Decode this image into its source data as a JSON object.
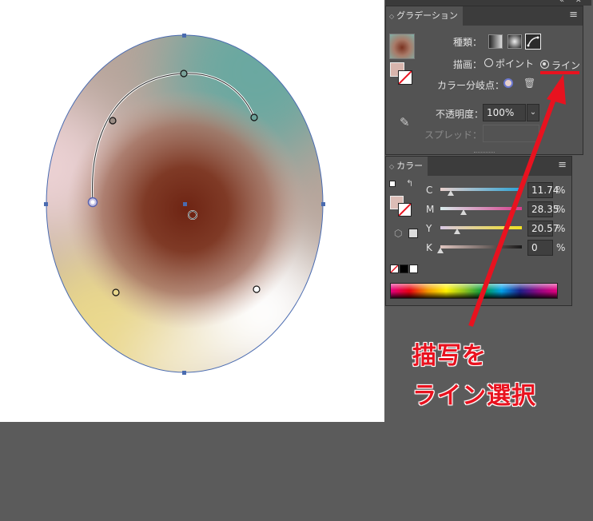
{
  "colors": {
    "accent": "#e8121f",
    "panel_bg": "#535353",
    "artboard": "#ffffff",
    "workspace": "#5b5b5b"
  },
  "gradient_panel": {
    "tab_label": "グラデーション",
    "menu_icon": "≡",
    "type_label": "種類：",
    "draw_label": "描画：",
    "draw_options": [
      "ポイント",
      "ライン"
    ],
    "draw_selected": "ライン",
    "color_stop_label": "カラー分岐点：",
    "opacity_label": "不透明度：",
    "opacity_value": "100%",
    "spread_label": "スプレッド："
  },
  "color_panel": {
    "tab_label": "カラー",
    "menu_icon": "≡",
    "channels": [
      {
        "name": "C",
        "value": "11.74",
        "unit": "%",
        "level": 0.117
      },
      {
        "name": "M",
        "value": "28.35",
        "unit": "%",
        "level": 0.284
      },
      {
        "name": "Y",
        "value": "20.57",
        "unit": "%",
        "level": 0.206
      },
      {
        "name": "K",
        "value": "0",
        "unit": "%",
        "level": 0.0
      }
    ]
  },
  "topbar": {
    "collapse": "«",
    "close": "✕"
  },
  "annotation": {
    "line1": "描写を",
    "line2": "ライン選択"
  }
}
